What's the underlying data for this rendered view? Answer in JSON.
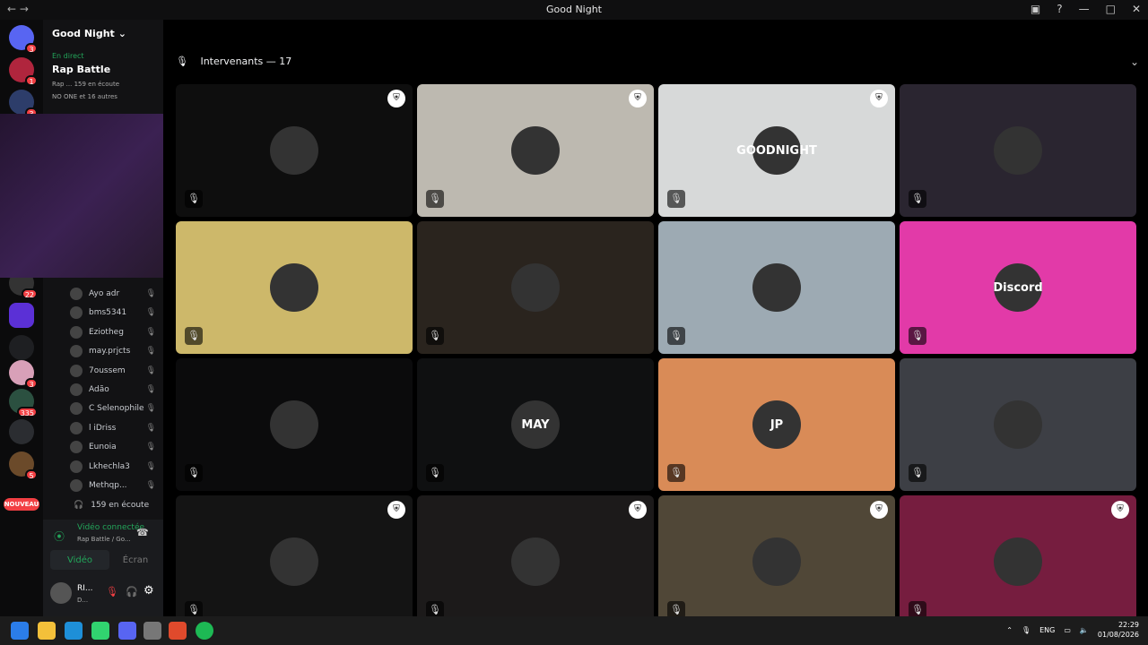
{
  "window": {
    "title": "Good Night"
  },
  "guild": {
    "name": "Good Night"
  },
  "stage": {
    "live_label": "En direct",
    "title": "Rap Battle",
    "subtitle": "Rap ...  159 en écoute",
    "others": "NO ONE et 16 autres"
  },
  "members": [
    {
      "name": "Ayo adr"
    },
    {
      "name": "bms5341"
    },
    {
      "name": "Eziotheg"
    },
    {
      "name": "may.prjcts"
    },
    {
      "name": "7oussem"
    },
    {
      "name": "Adão"
    },
    {
      "name": "C Selenophile"
    },
    {
      "name": "l iDriss"
    },
    {
      "name": "Eunoia"
    },
    {
      "name": "Lkhechla3"
    },
    {
      "name": "Methqp..."
    }
  ],
  "listeners": "159 en écoute",
  "voice": {
    "status": "Vidéo connectée",
    "channel": "Rap Battle / Go...",
    "video_label": "Vidéo",
    "screen_label": "Écran"
  },
  "user": {
    "name": "RI...",
    "sub": "D..."
  },
  "server_badges": {
    "b1": "3",
    "b2": "1",
    "b3": "3",
    "b4": "22",
    "b5": "3",
    "b6": "335",
    "b7": "5"
  },
  "new_badge": "NOUVEAU",
  "main": {
    "speakers_label": "Intervenants — 17"
  },
  "tiles": [
    {
      "bg": "#0e0e0e",
      "mod": true,
      "avatar": ""
    },
    {
      "bg": "#bdb9b0",
      "mod": true,
      "avatar": ""
    },
    {
      "bg": "#d7d9d9",
      "mod": true,
      "avatar": "GOODNIGHT"
    },
    {
      "bg": "#2a2530",
      "mod": false,
      "avatar": ""
    },
    {
      "bg": "#cdb86a",
      "mod": false,
      "avatar": ""
    },
    {
      "bg": "#2a241e",
      "mod": false,
      "avatar": ""
    },
    {
      "bg": "#9daab3",
      "mod": false,
      "avatar": ""
    },
    {
      "bg": "#e23aa8",
      "mod": false,
      "avatar": "Discord"
    },
    {
      "bg": "#0b0b0c",
      "mod": false,
      "avatar": ""
    },
    {
      "bg": "#0f1011",
      "mod": false,
      "avatar": "MAY"
    },
    {
      "bg": "#d98b57",
      "mod": false,
      "avatar": "JP"
    },
    {
      "bg": "#3d3f45",
      "mod": false,
      "avatar": ""
    },
    {
      "bg": "#141414",
      "mod": true,
      "avatar": ""
    },
    {
      "bg": "#1c1a1a",
      "mod": true,
      "avatar": ""
    },
    {
      "bg": "#504737",
      "mod": true,
      "avatar": ""
    },
    {
      "bg": "#761d3f",
      "mod": true,
      "avatar": ""
    }
  ],
  "taskbar": {
    "lang": "ENG",
    "time": "22:29",
    "date": "01/08/2026"
  }
}
